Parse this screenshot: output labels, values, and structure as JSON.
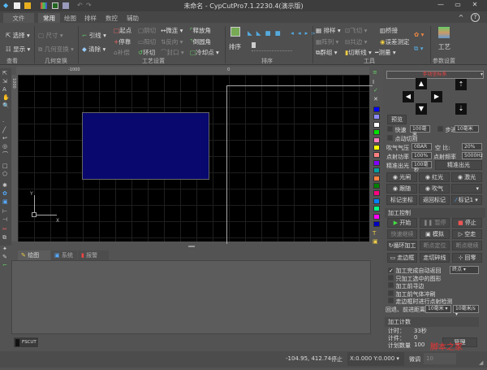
{
  "titlebar": {
    "title": "未命名 - CypCutPro7.1.2230.4(演示版)",
    "minimize": "—",
    "maximize": "▭",
    "close": "✕",
    "collapse": "^",
    "help": "?"
  },
  "menu_tabs": [
    "文件",
    "常用",
    "绘图",
    "排样",
    "数控",
    "辅助"
  ],
  "ribbon": {
    "view": {
      "select": "选择",
      "display": "显示",
      "group": "查看"
    },
    "geom": {
      "size": "尺寸",
      "transform": "几何变换",
      "group": "几何变换"
    },
    "process": {
      "lead": "引线",
      "clear": "清除",
      "start": "起点",
      "stop": "停靠",
      "comp": "补偿",
      "inner_cut": "阴切",
      "outer_cut": "阳切",
      "ring_cut": "环切",
      "micro": "微连",
      "reverse": "反向",
      "seal": "封口",
      "release_corner": "释放角",
      "round_corner": "倒圆角",
      "cooling": "冷却点",
      "group": "工艺设置"
    },
    "sort": {
      "label": "排序",
      "group": "排序"
    },
    "tools": {
      "nest": "排样",
      "flycut": "飞切",
      "array": "阵列",
      "common_edge": "共边",
      "grouping": "群组",
      "cut_line": "切断线",
      "bridge": "桥接",
      "error_measure": "误差测定",
      "measure": "测量",
      "group": "工具"
    },
    "params": {
      "label": "工艺",
      "group": "参数设置"
    }
  },
  "canvas": {
    "ruler_top": [
      "-1000",
      "0"
    ],
    "ruler_left": "1000",
    "axis_x": "X",
    "axis_y": "Y"
  },
  "colors": [
    "#0000ff",
    "#8a8aff",
    "#ffffff",
    "#00e000",
    "#ff80c0",
    "#ffff00",
    "#ff8080",
    "#8000ff",
    "#00a0a0",
    "#ff8040",
    "#008000",
    "#ff0080",
    "#0080ff",
    "#00ff80",
    "#ff00ff",
    "#0000c0"
  ],
  "right_panel": {
    "coord_system": "手动坐标系",
    "preview": "预览",
    "fast_label": "快速",
    "fast_value": "100毫米",
    "step_label": "步进",
    "step_value": "10毫米",
    "jog_cut": "点动切割",
    "air_pressure_label": "吹气气压",
    "air_pressure_value": "0BAR",
    "duty_label": "空 比:",
    "duty_value": "20%",
    "shot_power_label": "点射功率",
    "shot_power_value": "100%",
    "shot_freq_label": "点射频率",
    "shot_freq_value": "5000Hz",
    "precise_label": "精准出光",
    "precise_value": "100毫秒",
    "precise_button": "精准出光",
    "shutter": "光闸",
    "red_light": "红光",
    "laser": "激光",
    "follow": "跟随",
    "blow": "吹气",
    "mark_coord": "标记坐标",
    "return_mark": "返回标记",
    "mark1": "标记1",
    "control_title": "加工控制",
    "start": "开始",
    "pause": "暂停",
    "stop": "停止",
    "fast_continue": "快速继续",
    "simulate": "模拟",
    "dry_run": "空走",
    "loop": "循环加工",
    "breakpoint_locate": "断点定位",
    "breakpoint_continue": "断点继续",
    "frame": "走边框",
    "frame_cut": "走切碎线",
    "return_zero": "回零",
    "checks": [
      {
        "label": "加工完成自动返回",
        "checked": true
      },
      {
        "label": "只加工选中的图形",
        "checked": false
      },
      {
        "label": "加工前寻边",
        "checked": false
      },
      {
        "label": "加工前气体冲刷",
        "checked": false
      },
      {
        "label": "走边框时进行点射检测",
        "checked": false
      }
    ],
    "return_target": "终点",
    "back_forward_label": "回退、前进距离",
    "back_value": "10毫米",
    "forward_value": "10毫米/s",
    "count_title": "加工计数",
    "timer_label": "计时：",
    "timer_value": "33秒",
    "pieces_label": "计件：",
    "pieces_value": "0",
    "plan_label": "计划数量",
    "plan_value": "100",
    "manage": "管理"
  },
  "bottom_tabs": [
    "绘图",
    "系统",
    "报警"
  ],
  "fscut": "FSCUT",
  "status": {
    "coords": "-104.95, 412.74",
    "state": "停止",
    "xy": "X:0.000 Y:0.000",
    "fine_tune_label": "微调",
    "fine_tune_value": "10"
  },
  "watermark": "脚本之家"
}
